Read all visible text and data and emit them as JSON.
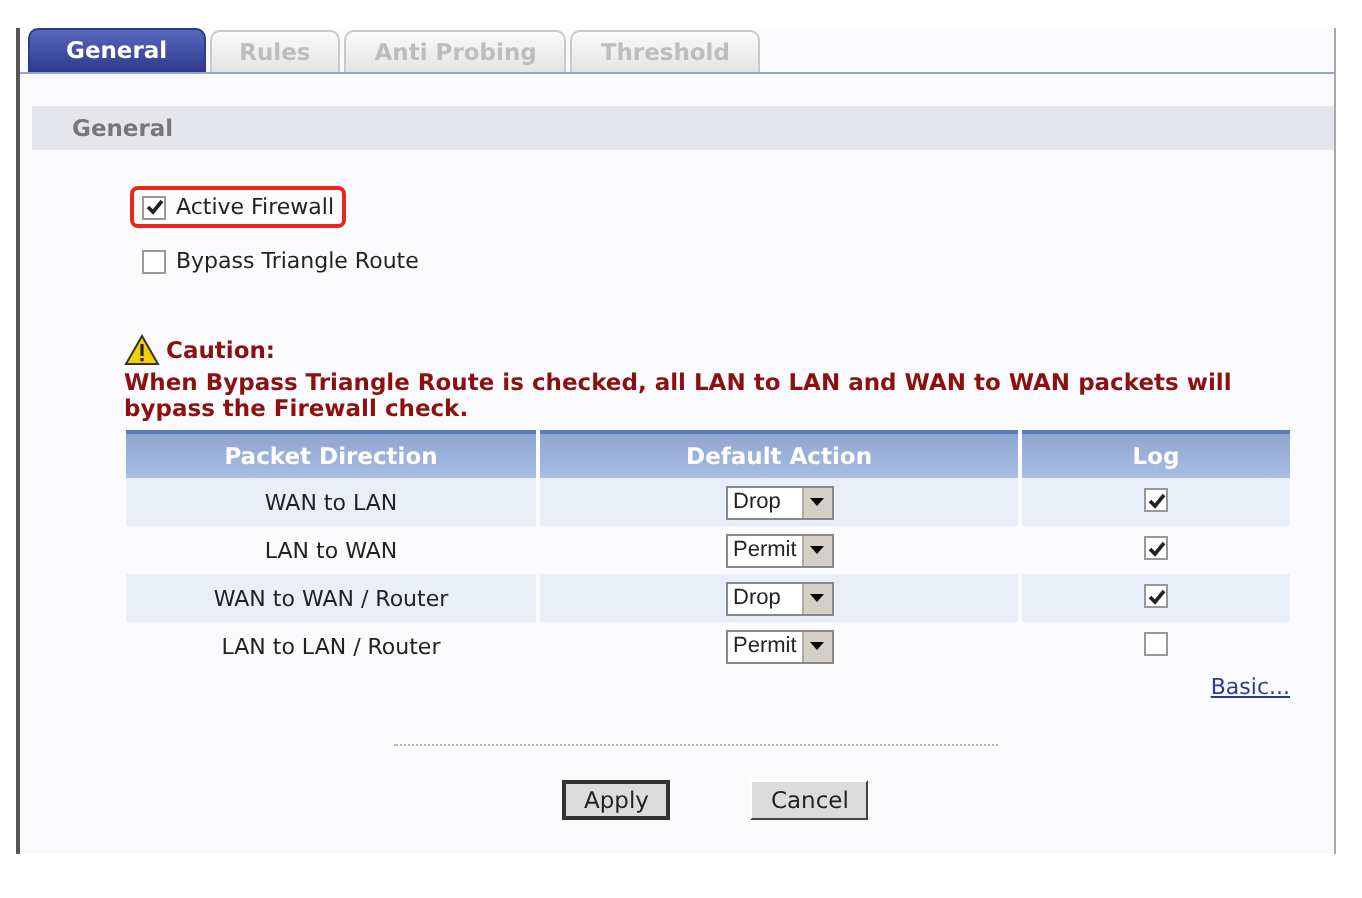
{
  "tabs": [
    {
      "label": "General",
      "selected": true
    },
    {
      "label": "Rules",
      "selected": false
    },
    {
      "label": "Anti Probing",
      "selected": false
    },
    {
      "label": "Threshold",
      "selected": false
    }
  ],
  "section": {
    "title": "General"
  },
  "options": [
    {
      "label": "Active Firewall",
      "checked": true,
      "highlighted": true
    },
    {
      "label": "Bypass Triangle Route",
      "checked": false,
      "highlighted": false
    }
  ],
  "caution": {
    "title": "Caution:",
    "message": "When Bypass Triangle Route is checked, all LAN to LAN and WAN to WAN packets will bypass the Firewall check."
  },
  "table": {
    "columns": [
      "Packet Direction",
      "Default Action",
      "Log"
    ],
    "rows": [
      {
        "direction": "WAN to LAN",
        "action": "Drop",
        "log": true
      },
      {
        "direction": "LAN to WAN",
        "action": "Permit",
        "log": true
      },
      {
        "direction": "WAN to WAN / Router",
        "action": "Drop",
        "log": true
      },
      {
        "direction": "LAN to LAN / Router",
        "action": "Permit",
        "log": false
      }
    ]
  },
  "link": "Basic...",
  "buttons": [
    "Apply",
    "Cancel"
  ]
}
